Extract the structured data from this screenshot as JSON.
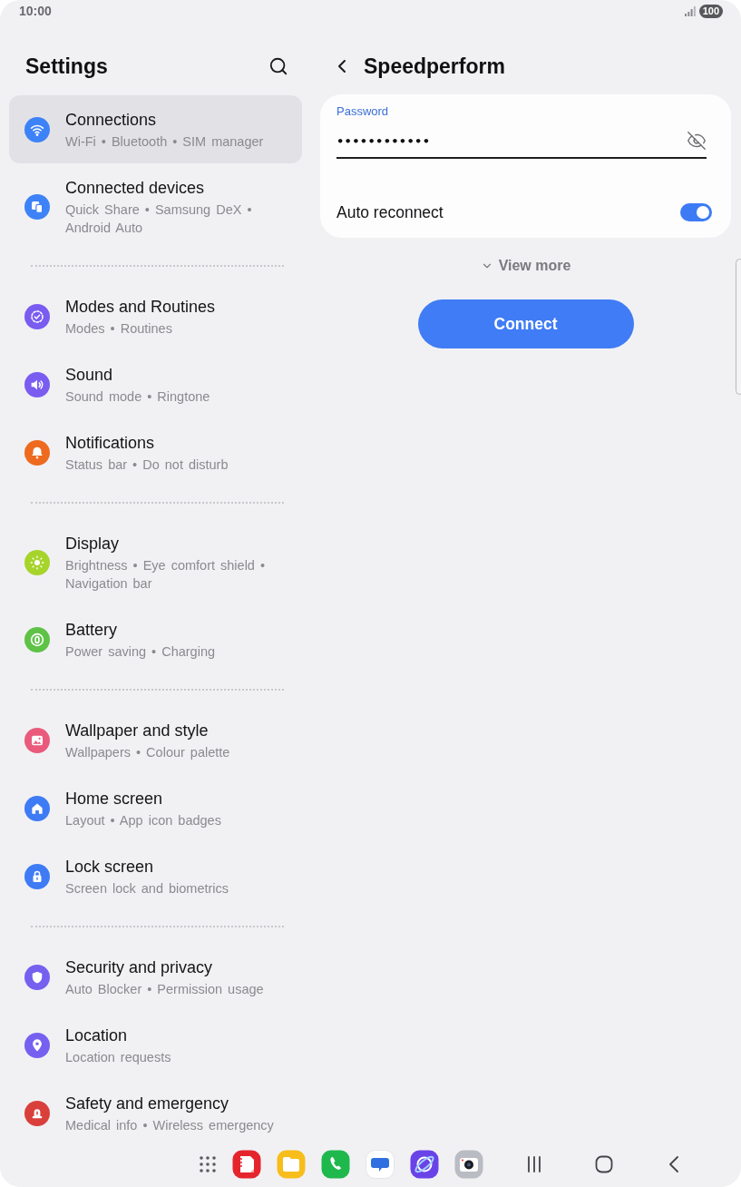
{
  "status_bar": {
    "time": "10:00",
    "battery": "100"
  },
  "sidebar": {
    "title": "Settings",
    "groups": [
      {
        "items": [
          {
            "title": "Connections",
            "subtitle": "Wi-Fi • Bluetooth • SIM manager",
            "color": "#3e82f7",
            "selected": true
          },
          {
            "title": "Connected devices",
            "subtitle": "Quick Share • Samsung DeX • Android Auto",
            "color": "#3e82f7",
            "selected": false
          }
        ]
      },
      {
        "items": [
          {
            "title": "Modes and Routines",
            "subtitle": "Modes • Routines",
            "color": "#7a5cf0",
            "selected": false
          },
          {
            "title": "Sound",
            "subtitle": "Sound mode • Ringtone",
            "color": "#7a5cf0",
            "selected": false
          },
          {
            "title": "Notifications",
            "subtitle": "Status bar • Do not disturb",
            "color": "#ee6a1f",
            "selected": false
          }
        ]
      },
      {
        "items": [
          {
            "title": "Display",
            "subtitle": "Brightness • Eye comfort shield • Navigation bar",
            "color": "#a6d42b",
            "selected": false
          },
          {
            "title": "Battery",
            "subtitle": "Power saving • Charging",
            "color": "#5ec247",
            "selected": false
          }
        ]
      },
      {
        "items": [
          {
            "title": "Wallpaper and style",
            "subtitle": "Wallpapers • Colour palette",
            "color": "#ea5a7c",
            "selected": false
          },
          {
            "title": "Home screen",
            "subtitle": "Layout • App icon badges",
            "color": "#3e7bf5",
            "selected": false
          },
          {
            "title": "Lock screen",
            "subtitle": "Screen lock and biometrics",
            "color": "#3e7bf5",
            "selected": false
          }
        ]
      },
      {
        "items": [
          {
            "title": "Security and privacy",
            "subtitle": "Auto Blocker • Permission usage",
            "color": "#7560f0",
            "selected": false
          },
          {
            "title": "Location",
            "subtitle": "Location requests",
            "color": "#7560f0",
            "selected": false
          },
          {
            "title": "Safety and emergency",
            "subtitle": "Medical info • Wireless emergency",
            "color": "#d9403b",
            "selected": false
          }
        ]
      }
    ]
  },
  "detail": {
    "title": "Speedperform",
    "password": {
      "label": "Password",
      "value": "••••••••••••"
    },
    "auto_reconnect": {
      "label": "Auto reconnect",
      "on": true
    },
    "view_more": "View more",
    "connect_button": "Connect"
  }
}
